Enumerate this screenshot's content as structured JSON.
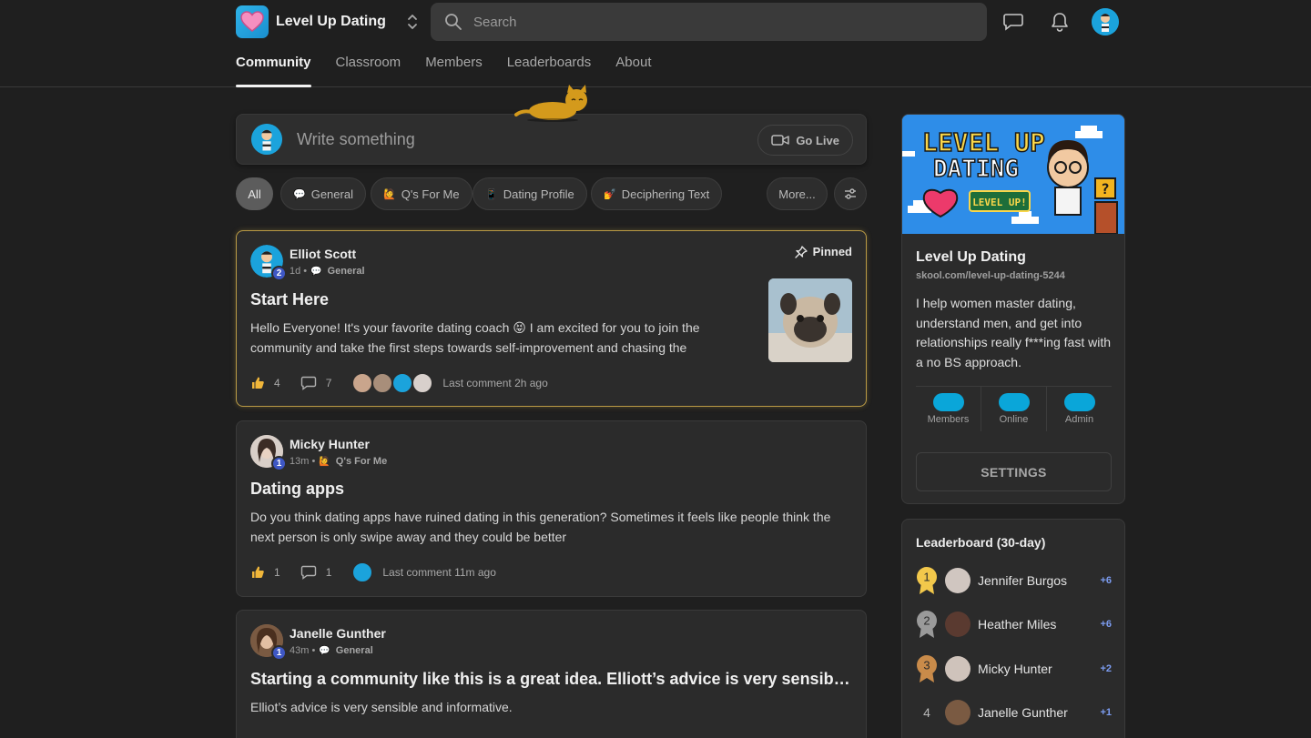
{
  "brand": {
    "name": "Level Up Dating"
  },
  "search": {
    "placeholder": "Search"
  },
  "tabs": [
    {
      "label": "Community",
      "active": true
    },
    {
      "label": "Classroom"
    },
    {
      "label": "Members"
    },
    {
      "label": "Leaderboards"
    },
    {
      "label": "About"
    }
  ],
  "composer": {
    "placeholder": "Write something",
    "go_live": "Go Live"
  },
  "filters": [
    {
      "label": "All",
      "active": true
    },
    {
      "label": "General",
      "emoji": "💬"
    },
    {
      "label": "Q's For Me",
      "emoji": "🙋"
    },
    {
      "label": "Dating Profile",
      "emoji": "📱"
    },
    {
      "label": "Deciphering Text",
      "emoji": "💅"
    },
    {
      "label": "More..."
    }
  ],
  "posts": [
    {
      "author": "Elliot Scott",
      "level": "2",
      "time": "1d",
      "category": "General",
      "category_emoji": "💬",
      "pinned_label": "Pinned",
      "title": "Start Here",
      "body": "Hello Everyone! It's your favorite dating coach 😝 I am excited for you to join the community and take the first steps towards self-improvement and chasing the",
      "likes": "4",
      "comments": "7",
      "last_comment": "Last comment 2h ago"
    },
    {
      "author": "Micky Hunter",
      "level": "1",
      "time": "13m",
      "category": "Q's For Me",
      "category_emoji": "🙋",
      "title": "Dating apps",
      "body": "Do you think dating apps have ruined dating in this generation? Sometimes it feels like people think the next person is only swipe away and they could be better",
      "likes": "1",
      "comments": "1",
      "last_comment": "Last comment 11m ago"
    },
    {
      "author": "Janelle Gunther",
      "level": "1",
      "time": "43m",
      "category": "General",
      "category_emoji": "💬",
      "title": "Starting a community like this is a great idea. Elliott’s advice is very sensible and informative.",
      "body": "Elliot’s advice is very sensible and informative."
    }
  ],
  "sidebar": {
    "banner_line1": "LEVEL UP",
    "banner_line2": "DATING",
    "banner_badge": "LEVEL UP!",
    "name": "Level Up Dating",
    "url": "skool.com/level-up-dating-5244",
    "description": "I help women master dating, understand men, and get into relationships really f***ing fast with a no BS approach.",
    "stats": [
      {
        "label": "Members"
      },
      {
        "label": "Online"
      },
      {
        "label": "Admin"
      }
    ],
    "settings_label": "SETTINGS"
  },
  "leaderboard": {
    "title": "Leaderboard (30-day)",
    "rows": [
      {
        "rank": "1",
        "name": "Jennifer Burgos",
        "points": "+6",
        "medal": "#f2c84b"
      },
      {
        "rank": "2",
        "name": "Heather Miles",
        "points": "+6",
        "medal": "#9a9a9a"
      },
      {
        "rank": "3",
        "name": "Micky Hunter",
        "points": "+2",
        "medal": "#c98b4a"
      },
      {
        "rank": "4",
        "name": "Janelle Gunther",
        "points": "+1"
      }
    ]
  },
  "colors": {
    "accent_blue": "#1ba3dc",
    "pinned_border": "#b99a45",
    "level_badge": "#3e57c4",
    "points": "#7c9cf0"
  }
}
